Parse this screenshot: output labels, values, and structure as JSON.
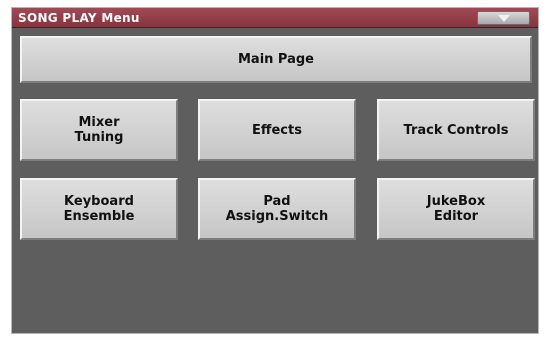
{
  "header": {
    "title": "SONG PLAY Menu",
    "menu_icon": "chevron-down-icon"
  },
  "buttons": {
    "main_page": "Main Page",
    "mixer_tuning": "Mixer\nTuning",
    "effects": "Effects",
    "track_controls": "Track Controls",
    "keyboard_ensemble": "Keyboard\nEnsemble",
    "pad_assign_switch": "Pad\nAssign.Switch",
    "jukebox_editor": "JukeBox\nEditor"
  },
  "colors": {
    "title_bar": "#8e3a45",
    "background": "#5e5e5e",
    "button_face": "#d2d2d2"
  }
}
